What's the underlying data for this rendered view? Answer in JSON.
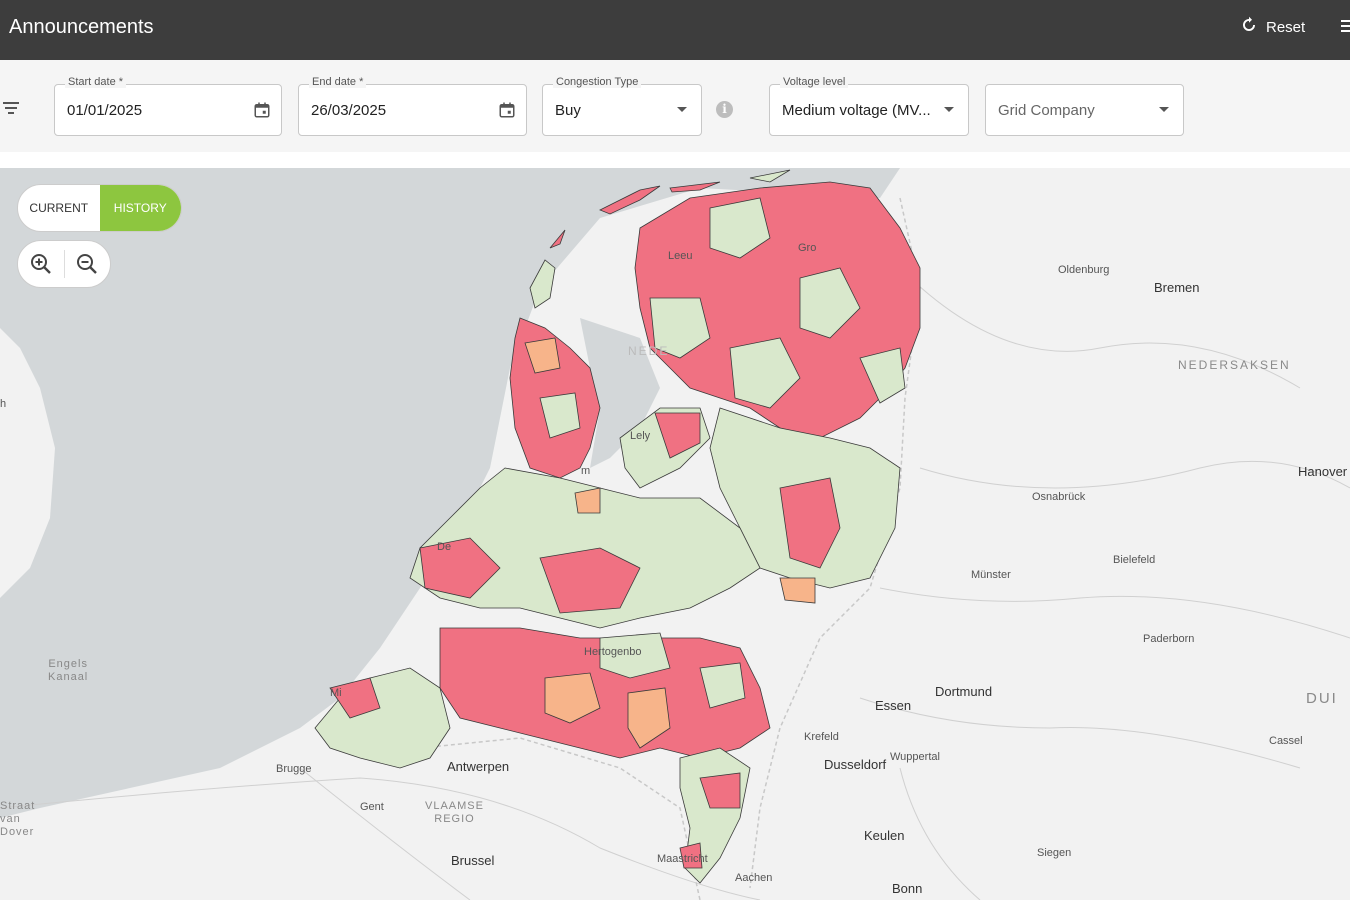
{
  "header": {
    "title": "Announcements",
    "reset_label": "Reset"
  },
  "filters": {
    "start_date": {
      "label": "Start date *",
      "value": "01/01/2025"
    },
    "end_date": {
      "label": "End date *",
      "value": "26/03/2025"
    },
    "congestion_type": {
      "label": "Congestion Type",
      "value": "Buy"
    },
    "voltage_level": {
      "label": "Voltage level",
      "value": "Medium voltage (MV..."
    },
    "grid_company": {
      "placeholder": "Grid Company"
    }
  },
  "view_toggle": {
    "current_label": "CURRENT",
    "history_label": "HISTORY",
    "active": "HISTORY"
  },
  "colors": {
    "congested_red": "#f07182",
    "no_congestion_green": "#d9e8cc",
    "partial_orange": "#f7b48a",
    "history_active": "#8dc63f",
    "sea": "#d3d7d9",
    "land": "#f2f2f2"
  },
  "map": {
    "labels": {
      "oldenburg": "Oldenburg",
      "bremen": "Bremen",
      "nedersaksen": "NEDERSAKSEN",
      "hanover": "Hanover",
      "osnabruck": "Osnabrück",
      "bielefeld": "Bielefeld",
      "munster": "Münster",
      "paderborn": "Paderborn",
      "dortmund": "Dortmund",
      "essen": "Essen",
      "krefeld": "Krefeld",
      "wuppertal": "Wuppertal",
      "dusseldorf": "Dusseldorf",
      "kassel": "Cassel",
      "dui": "DUI",
      "keulen": "Keulen",
      "siegen": "Siegen",
      "bonn": "Bonn",
      "aachen": "Aachen",
      "brussel": "Brussel",
      "antwerpen": "Antwerpen",
      "brugge": "Brugge",
      "gent": "Gent",
      "vlaamse_regio": "VLAAMSE\nREGIO",
      "engels_kanaal": "Engels\nKanaal",
      "straat_van_dover": "Straat\nvan\nDover",
      "h": "h",
      "leeuwarden": "Leeu",
      "groningen": "Gro",
      "lelystad": "Lely",
      "amsterdam": "m",
      "den_haag": "De",
      "middelburg": "Mi",
      "hertogenbosch": "Hertogenbo",
      "maastricht": "Maastricht",
      "ne": "NEDE"
    }
  }
}
